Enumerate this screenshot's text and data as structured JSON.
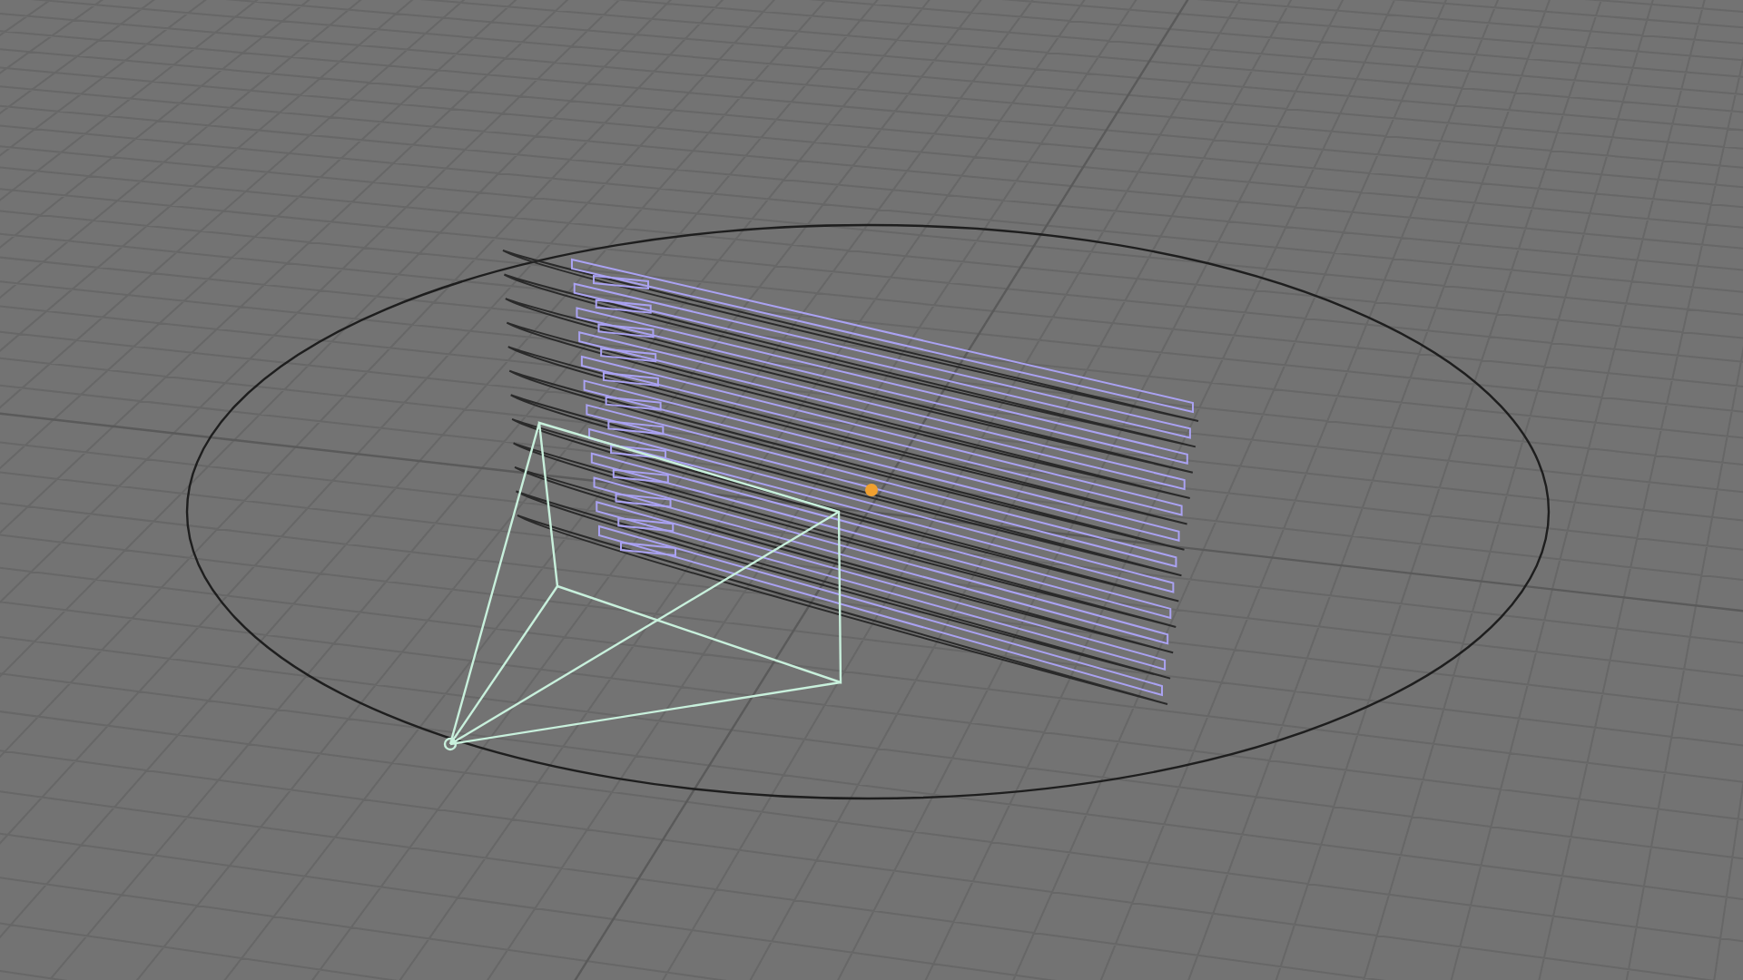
{
  "viewport": {
    "objects": [
      {
        "kind": "circle",
        "selected": false
      },
      {
        "kind": "plane-stack",
        "selected": true
      },
      {
        "kind": "camera",
        "selected": false
      }
    ]
  }
}
